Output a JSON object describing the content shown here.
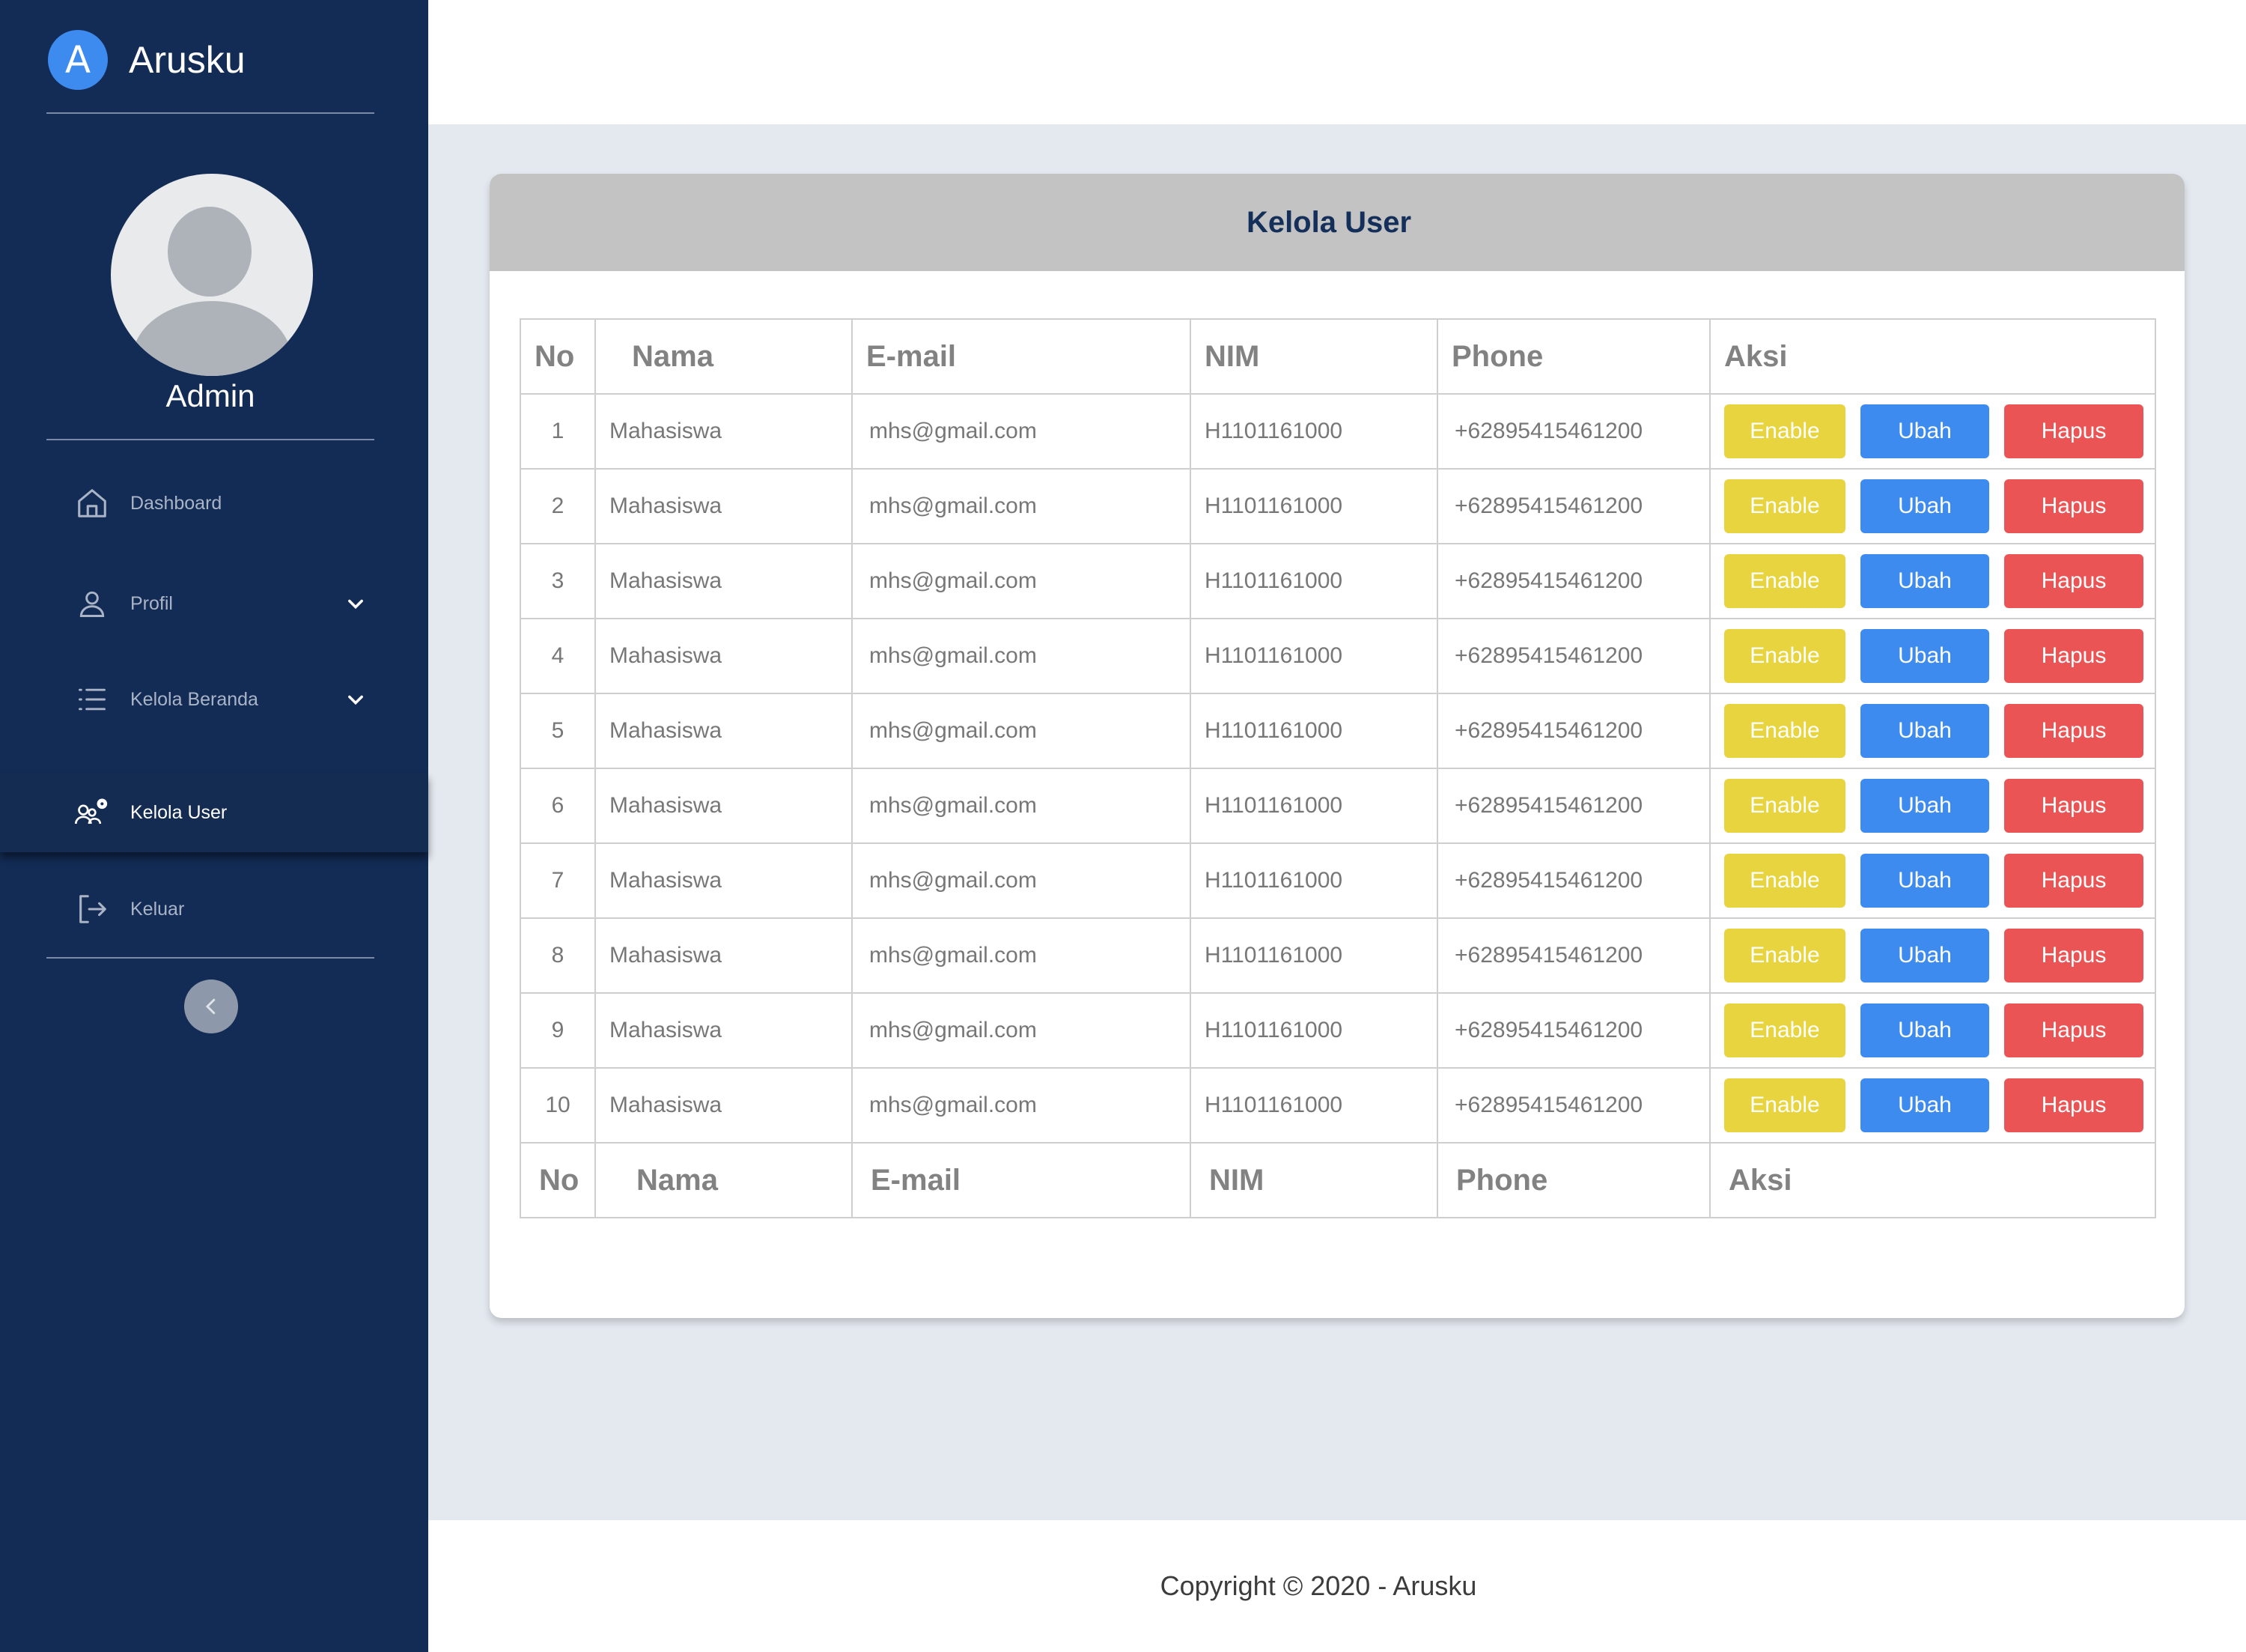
{
  "brand": {
    "logo_letter": "A",
    "name": "Arusku"
  },
  "sidebar": {
    "user_name": "Admin",
    "items": [
      {
        "label": "Dashboard",
        "icon": "home-icon"
      },
      {
        "label": "Profil",
        "icon": "user-icon"
      },
      {
        "label": "Kelola Beranda",
        "icon": "list-icon"
      },
      {
        "label": "Kelola User",
        "icon": "users-gear-icon"
      },
      {
        "label": "Keluar",
        "icon": "logout-icon"
      }
    ]
  },
  "card": {
    "title": "Kelola User"
  },
  "table": {
    "headers": {
      "no": "No",
      "nama": "Nama",
      "email": "E-mail",
      "nim": "NIM",
      "phone": "Phone",
      "aksi": "Aksi"
    },
    "buttons": {
      "enable": "Enable",
      "ubah": "Ubah",
      "hapus": "Hapus"
    },
    "rows": [
      {
        "no": "1",
        "nama": "Mahasiswa",
        "email": "mhs@gmail.com",
        "nim": "H1101161000",
        "phone": "+62895415461200"
      },
      {
        "no": "2",
        "nama": "Mahasiswa",
        "email": "mhs@gmail.com",
        "nim": "H1101161000",
        "phone": "+62895415461200"
      },
      {
        "no": "3",
        "nama": "Mahasiswa",
        "email": "mhs@gmail.com",
        "nim": "H1101161000",
        "phone": "+62895415461200"
      },
      {
        "no": "4",
        "nama": "Mahasiswa",
        "email": "mhs@gmail.com",
        "nim": "H1101161000",
        "phone": "+62895415461200"
      },
      {
        "no": "5",
        "nama": "Mahasiswa",
        "email": "mhs@gmail.com",
        "nim": "H1101161000",
        "phone": "+62895415461200"
      },
      {
        "no": "6",
        "nama": "Mahasiswa",
        "email": "mhs@gmail.com",
        "nim": "H1101161000",
        "phone": "+62895415461200"
      },
      {
        "no": "7",
        "nama": "Mahasiswa",
        "email": "mhs@gmail.com",
        "nim": "H1101161000",
        "phone": "+62895415461200"
      },
      {
        "no": "8",
        "nama": "Mahasiswa",
        "email": "mhs@gmail.com",
        "nim": "H1101161000",
        "phone": "+62895415461200"
      },
      {
        "no": "9",
        "nama": "Mahasiswa",
        "email": "mhs@gmail.com",
        "nim": "H1101161000",
        "phone": "+62895415461200"
      },
      {
        "no": "10",
        "nama": "Mahasiswa",
        "email": "mhs@gmail.com",
        "nim": "H1101161000",
        "phone": "+62895415461200"
      }
    ]
  },
  "footer": {
    "copyright": "Copyright © 2020 - Arusku"
  },
  "colors": {
    "sidebar": "#132c55",
    "enable": "#e7d43e",
    "ubah": "#3d8bef",
    "hapus": "#ea5455"
  }
}
